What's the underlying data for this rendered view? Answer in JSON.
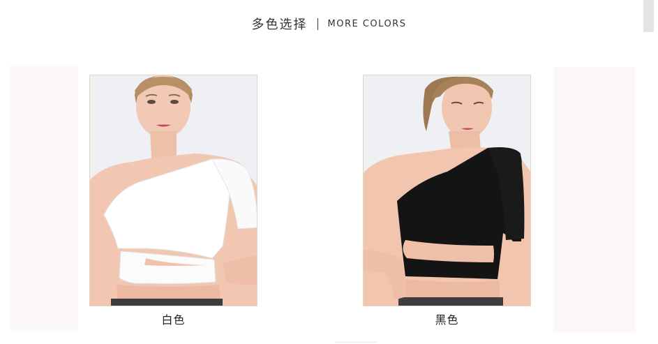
{
  "header": {
    "title_cn": "多色选择",
    "title_en": "MORE COLORS"
  },
  "products": [
    {
      "caption": "白色",
      "garment_color": "#ffffff"
    },
    {
      "caption": "黑色",
      "garment_color": "#111111"
    }
  ]
}
